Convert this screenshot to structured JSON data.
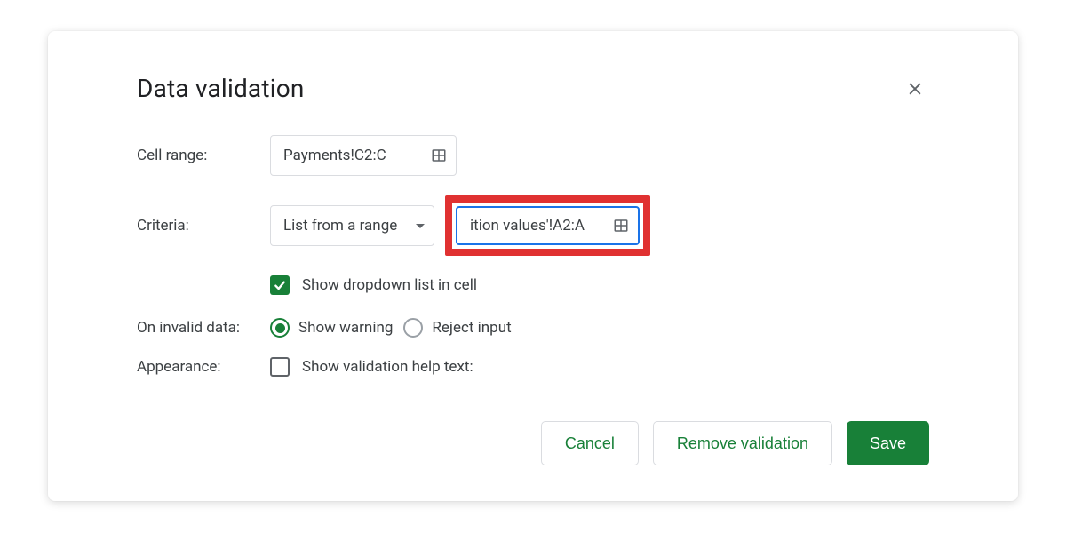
{
  "dialog": {
    "title": "Data validation"
  },
  "cellRange": {
    "label": "Cell range:",
    "value": "Payments!C2:C"
  },
  "criteria": {
    "label": "Criteria:",
    "type": "List from a range",
    "rangeValue": "ition values'!A2:A"
  },
  "showDropdown": {
    "label": "Show dropdown list in cell"
  },
  "onInvalid": {
    "label": "On invalid data:",
    "options": {
      "warning": "Show warning",
      "reject": "Reject input"
    }
  },
  "appearance": {
    "label": "Appearance:",
    "helpText": "Show validation help text:"
  },
  "buttons": {
    "cancel": "Cancel",
    "remove": "Remove validation",
    "save": "Save"
  }
}
